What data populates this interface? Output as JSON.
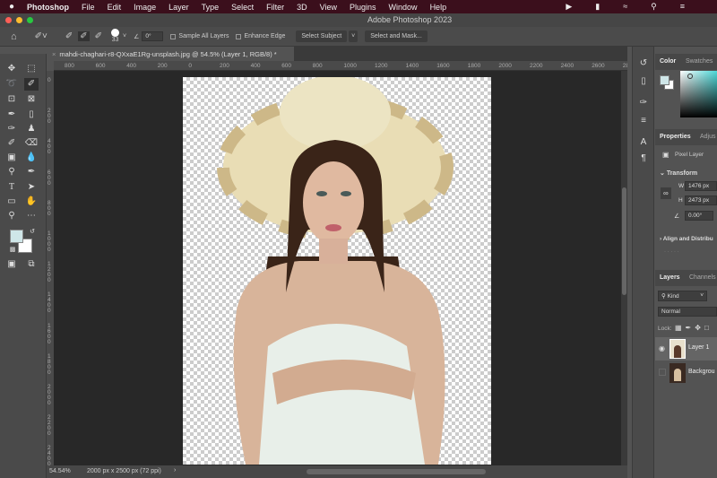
{
  "menubar": {
    "app": "Photoshop",
    "items": [
      "File",
      "Edit",
      "Image",
      "Layer",
      "Type",
      "Select",
      "Filter",
      "3D",
      "View",
      "Plugins",
      "Window",
      "Help"
    ]
  },
  "window": {
    "title": "Adobe Photoshop 2023"
  },
  "options": {
    "brush_size": "33",
    "angle": "0°",
    "sample_all_layers": "Sample All Layers",
    "enhance_edge": "Enhance Edge",
    "select_subject": "Select Subject",
    "select_and_mask": "Select and Mask..."
  },
  "document": {
    "tab_title": "mahdi-chaghari-r8-QXxaE1Rg-unsplash.jpg @ 54.5% (Layer 1, RGB/8) *",
    "zoom": "54.54%",
    "dimensions": "2000 px x 2500 px (72 ppi)"
  },
  "rulers": {
    "horizontal": [
      "800",
      "600",
      "400",
      "200",
      "0",
      "200",
      "400",
      "600",
      "800",
      "1000",
      "1200",
      "1400",
      "1600",
      "1800",
      "2000",
      "2200",
      "2400",
      "2600",
      "28"
    ],
    "vertical": [
      "0",
      "200",
      "400",
      "600",
      "800",
      "1000",
      "1200",
      "1400",
      "1600",
      "1800",
      "2000",
      "2200",
      "2400"
    ]
  },
  "color_panel": {
    "tabs": [
      "Color",
      "Swatches"
    ],
    "foreground": "#cfe6e8",
    "background": "#ffffff"
  },
  "properties": {
    "tabs": [
      "Properties",
      "Adjus"
    ],
    "kind": "Pixel Layer",
    "transform_label": "Transform",
    "w_label": "W",
    "w": "1476 px",
    "h_label": "H",
    "h": "2473 px",
    "angle": "0.00°",
    "align": "Align and Distribu"
  },
  "layers": {
    "tabs": [
      "Layers",
      "Channels"
    ],
    "filter": "Kind",
    "blend": "Normal",
    "lock_label": "Lock:",
    "items": [
      {
        "name": "Layer 1",
        "visible": true
      },
      {
        "name": "Backgrou",
        "visible": false
      }
    ]
  }
}
